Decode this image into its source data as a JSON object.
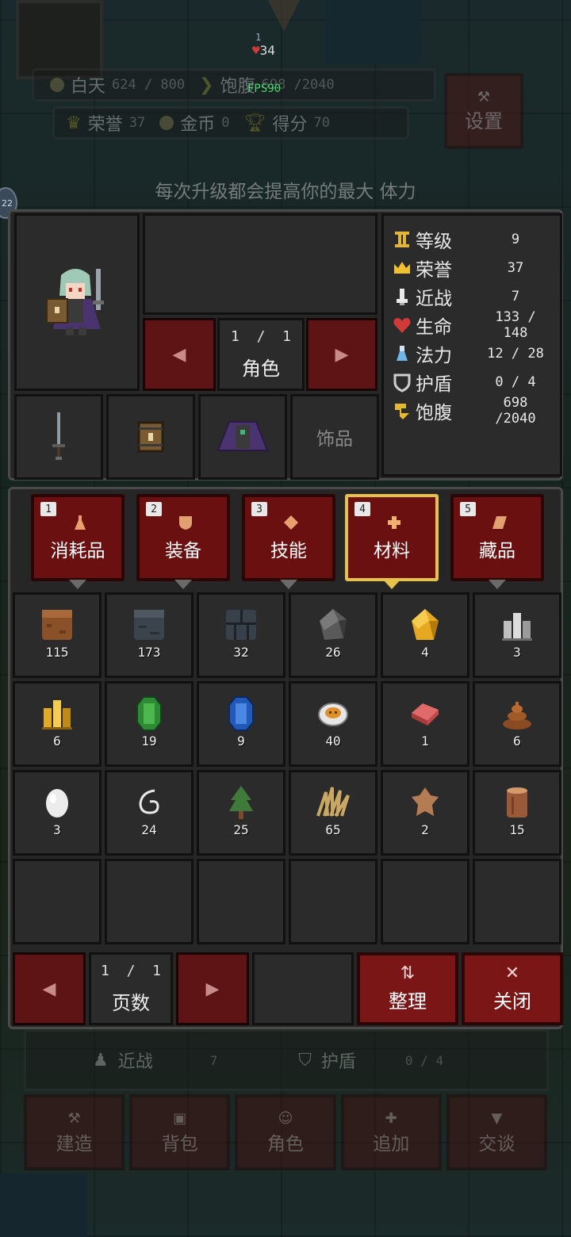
{
  "hud": {
    "day_label": "白天",
    "day_value": "624 / 800",
    "hunger_label": "饱腹",
    "hunger_value": "698 /2040",
    "honor_label": "荣誉",
    "honor_value": "37",
    "gold_label": "金币",
    "gold_value": "0",
    "score_label": "得分",
    "score_value": "70",
    "settings_label": "设置",
    "fps": "FPS90",
    "top_count_small": "1",
    "top_hp": "34",
    "side_badge": "22"
  },
  "hint": "每次升级都会提高你的最大 体力",
  "character": {
    "page_current": "1",
    "page_sep": "/",
    "page_total": "1",
    "page_label": "角色",
    "accessory_slot_label": "饰品"
  },
  "stats": [
    {
      "label": "等级",
      "value": "9",
      "icon": "pillar-icon",
      "color": "#e2b33a"
    },
    {
      "label": "荣誉",
      "value": "37",
      "icon": "crown-icon",
      "color": "#f0c030"
    },
    {
      "label": "近战",
      "value": "7",
      "icon": "fist-icon",
      "color": "#e8e8e8"
    },
    {
      "label": "生命",
      "value": "133 / 148",
      "icon": "heart-icon",
      "color": "#d23a3a"
    },
    {
      "label": "法力",
      "value": "12 / 28",
      "icon": "potion-icon",
      "color": "#6fb6e6"
    },
    {
      "label": "护盾",
      "value": "0 / 4",
      "icon": "shield-icon",
      "color": "#cfcfcf"
    },
    {
      "label": "饱腹",
      "value": "698 /2040",
      "icon": "drumstick-icon",
      "color": "#e6b830"
    }
  ],
  "tabs": [
    {
      "key": "1",
      "label": "消耗品",
      "icon": "flask-icon",
      "active": false
    },
    {
      "key": "2",
      "label": "装备",
      "icon": "armor-icon",
      "active": false
    },
    {
      "key": "3",
      "label": "技能",
      "icon": "diamond-icon",
      "active": false
    },
    {
      "key": "4",
      "label": "材料",
      "icon": "cross-icon",
      "active": true
    },
    {
      "key": "5",
      "label": "藏品",
      "icon": "scroll-icon",
      "active": false
    }
  ],
  "items": [
    {
      "icon": "dirt-block-icon",
      "qty": "115",
      "color": "#8a5028"
    },
    {
      "icon": "stone-block-icon",
      "qty": "173",
      "color": "#3b444c"
    },
    {
      "icon": "stone-brick-icon",
      "qty": "32",
      "color": "#38414a"
    },
    {
      "icon": "coal-ore-icon",
      "qty": "26",
      "color": "#5a5a5a"
    },
    {
      "icon": "gold-nugget-icon",
      "qty": "4",
      "color": "#e6a820"
    },
    {
      "icon": "iron-ingot-icon",
      "qty": "3",
      "color": "#bfbfbf"
    },
    {
      "icon": "gold-ingot-icon",
      "qty": "6",
      "color": "#e2aa22"
    },
    {
      "icon": "emerald-icon",
      "qty": "19",
      "color": "#2e8a34"
    },
    {
      "icon": "sapphire-icon",
      "qty": "9",
      "color": "#2258b8"
    },
    {
      "icon": "fried-egg-icon",
      "qty": "40",
      "color": "#e0902a"
    },
    {
      "icon": "raw-meat-icon",
      "qty": "1",
      "color": "#e06a6a"
    },
    {
      "icon": "dung-icon",
      "qty": "6",
      "color": "#8a4a22"
    },
    {
      "icon": "egg-icon",
      "qty": "3",
      "color": "#ececec"
    },
    {
      "icon": "string-icon",
      "qty": "24",
      "color": "#e8e8e8"
    },
    {
      "icon": "sapling-icon",
      "qty": "25",
      "color": "#3f7a3a"
    },
    {
      "icon": "grass-tuft-icon",
      "qty": "65",
      "color": "#c8a862"
    },
    {
      "icon": "leather-icon",
      "qty": "2",
      "color": "#b47c52"
    },
    {
      "icon": "log-icon",
      "qty": "15",
      "color": "#9a5a3a"
    }
  ],
  "inventory_pager": {
    "page_current": "1",
    "page_sep": "/",
    "page_total": "1",
    "page_label": "页数",
    "sort_label": "整理",
    "close_label": "关闭"
  },
  "bottom_hud": {
    "melee_label": "近战",
    "melee_value": "7",
    "shield_label": "护盾",
    "shield_value": "0 / 4"
  },
  "dock": [
    {
      "label": "建造",
      "icon": "hammer-icon"
    },
    {
      "label": "背包",
      "icon": "backpack-icon"
    },
    {
      "label": "角色",
      "icon": "person-icon"
    },
    {
      "label": "追加",
      "icon": "plus-icon"
    },
    {
      "label": "交谈",
      "icon": "chat-icon"
    }
  ]
}
